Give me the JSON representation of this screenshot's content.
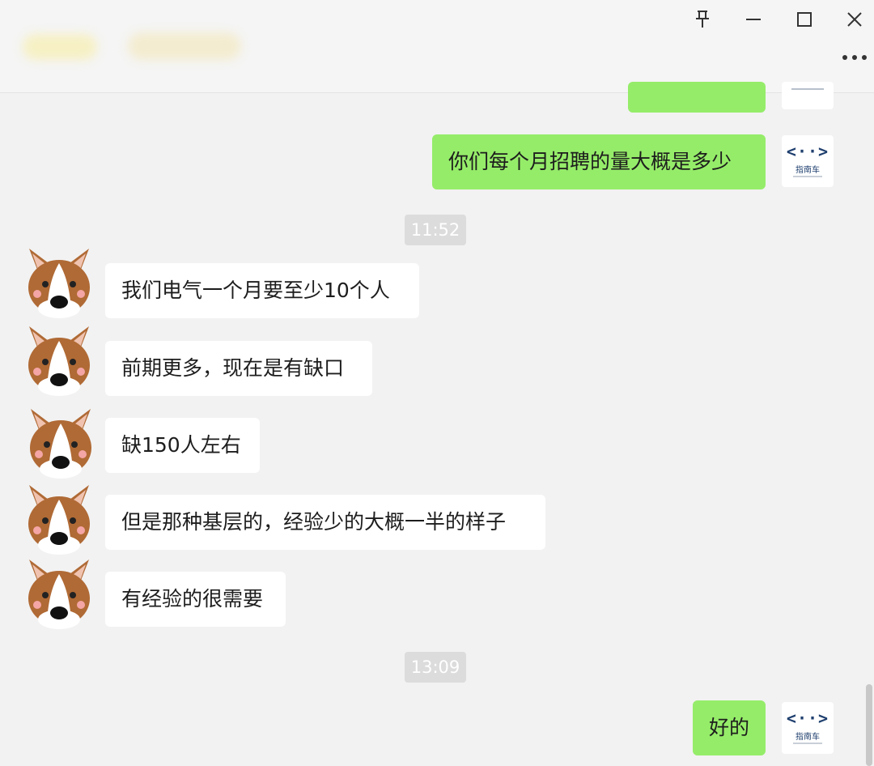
{
  "window": {
    "controls": {
      "pin_icon": "pin-icon",
      "minimize_icon": "minimize-icon",
      "maximize_icon": "maximize-icon",
      "close_icon": "close-icon",
      "more_icon": "more-icon"
    }
  },
  "colors": {
    "outgoing_bubble": "#95ec69",
    "incoming_bubble": "#ffffff",
    "background": "#f2f2f2",
    "timestamp_bg": "#dcdcdc"
  },
  "messages": {
    "outgoing_1": "你们每个月招聘的量大概是多少",
    "timestamp_1": "11:52",
    "incoming_1": "我们电气一个月要至少10个人",
    "incoming_2": "前期更多，现在是有缺口",
    "incoming_3": "缺150人左右",
    "incoming_4": "但是那种基层的，经验少的大概一半的样子",
    "incoming_5": "有经验的很需要",
    "timestamp_2": "13:09",
    "outgoing_2": "好的"
  },
  "self_avatar": {
    "logo_symbol": "<··>",
    "logo_text": "指南车"
  }
}
